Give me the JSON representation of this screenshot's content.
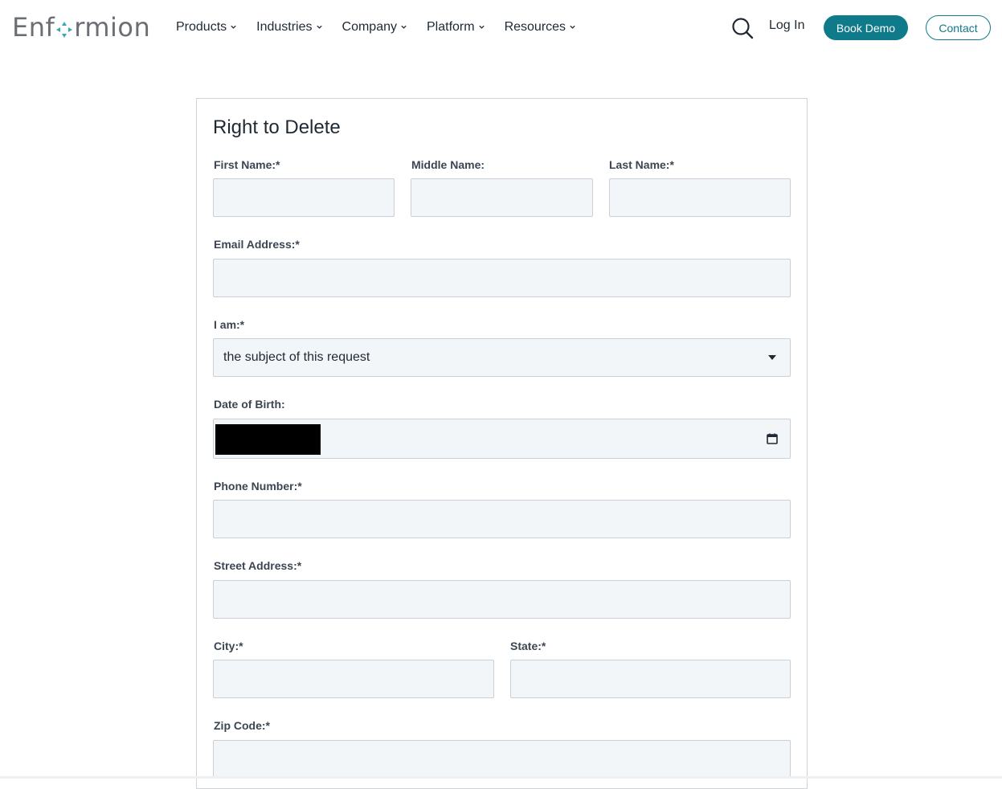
{
  "header": {
    "logo_text_left": "Enf",
    "logo_text_right": "rmion",
    "nav": [
      {
        "label": "Products"
      },
      {
        "label": "Industries"
      },
      {
        "label": "Company"
      },
      {
        "label": "Platform"
      },
      {
        "label": "Resources"
      }
    ],
    "login_label": "Log In",
    "book_demo_label": "Book Demo",
    "contact_label": "Contact",
    "brand_color": "#0f7a8a"
  },
  "form": {
    "title": "Right to Delete",
    "labels": {
      "first_name": "First Name:*",
      "middle_name": "Middle Name:",
      "last_name": "Last Name:*",
      "email": "Email Address:*",
      "i_am": "I am:*",
      "dob": "Date of Birth:",
      "phone": "Phone Number:*",
      "street": "Street Address:*",
      "city": "City:*",
      "state": "State:*",
      "zip": "Zip Code:*"
    },
    "i_am_selected": "the subject of this request"
  }
}
